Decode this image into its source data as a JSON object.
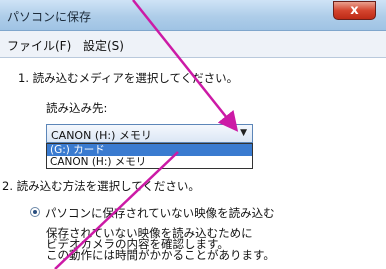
{
  "window": {
    "title": "パソコンに保存",
    "close_glyph": "x"
  },
  "menu": {
    "items": [
      {
        "label": "ファイル(F)"
      },
      {
        "label": "設定(S)"
      }
    ]
  },
  "step1": {
    "heading": "1. 読み込むメディアを選択してください。",
    "source_label": "読み込み先:",
    "select_value": "CANON (H:) メモリ",
    "options": [
      {
        "label": "(G:) カード",
        "selected": true
      },
      {
        "label": "CANON (H:) メモリ",
        "selected": false
      }
    ]
  },
  "step2": {
    "heading": "2. 読み込む方法を選択してください。",
    "radio_label": "パソコンに保存されていない映像を読み込む",
    "description_lines": [
      "保存されていない映像を読み込むために",
      "ビデオカメラの内容を確認します。",
      "この動作には時間がかかることがあります。"
    ]
  },
  "annotation": {
    "color": "#cc1aa6"
  }
}
